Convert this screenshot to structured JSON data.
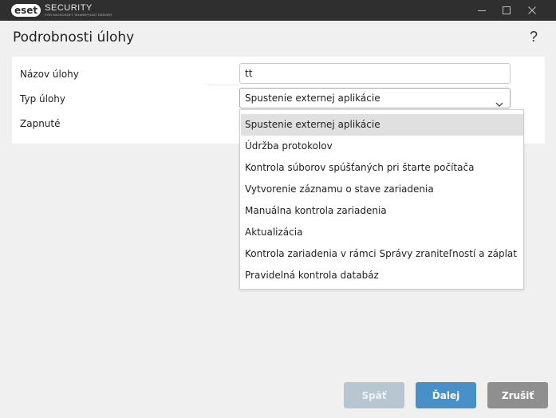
{
  "titlebar": {
    "logo_badge": "eset",
    "logo_main": "SECURITY",
    "logo_sub": "FOR MICROSOFT SHAREPOINT SERVER",
    "minimize_icon": "minimize-icon",
    "maximize_icon": "maximize-icon",
    "close_icon": "close-icon"
  },
  "page": {
    "title": "Podrobnosti úlohy",
    "help_label": "?"
  },
  "form": {
    "name_label": "Názov úlohy",
    "name_value": "tt",
    "type_label": "Typ úlohy",
    "type_value": "Spustenie externej aplikácie",
    "enabled_label": "Zapnuté"
  },
  "dropdown": {
    "options": [
      "Spustenie externej aplikácie",
      "Údržba protokolov",
      "Kontrola súborov spúšťaných pri štarte počítača",
      "Vytvorenie záznamu o stave zariadenia",
      "Manuálna kontrola zariadenia",
      "Aktualizácia",
      "Kontrola zariadenia v rámci Správy zraniteľností a záplat",
      "Pravidelná kontrola databáz"
    ],
    "selected_index": 0
  },
  "buttons": {
    "back": "Späť",
    "next": "Ďalej",
    "cancel": "Zrušiť"
  },
  "colors": {
    "titlebar": "#2f2f2f",
    "background": "#f0f0f0",
    "primary_button": "#4a90c8",
    "disabled_button": "#b8c6d1",
    "cancel_button": "#8f8f8f",
    "selected_option": "#e0e0e0"
  }
}
